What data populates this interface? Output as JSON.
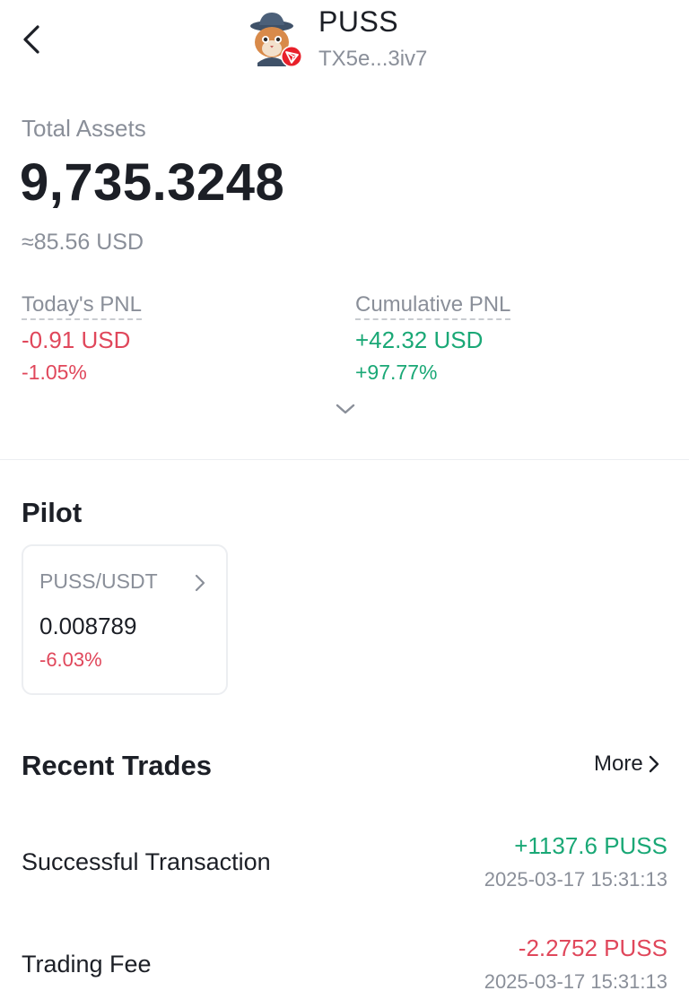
{
  "header": {
    "token_name": "PUSS",
    "address": "TX5e...3iv7"
  },
  "assets": {
    "label": "Total Assets",
    "value": "9,735.3248",
    "usd": "≈85.56 USD"
  },
  "pnl": {
    "today": {
      "label": "Today's PNL",
      "amount": "-0.91 USD",
      "percent": "-1.05%"
    },
    "cumulative": {
      "label": "Cumulative PNL",
      "amount": "+42.32 USD",
      "percent": "+97.77%"
    }
  },
  "pilot": {
    "title": "Pilot",
    "card": {
      "pair": "PUSS/USDT",
      "price": "0.008789",
      "change": "-6.03%"
    }
  },
  "recent_trades": {
    "title": "Recent Trades",
    "more_label": "More",
    "items": [
      {
        "title": "Successful Transaction",
        "amount": "+1137.6 PUSS",
        "time": "2025-03-17 15:31:13"
      },
      {
        "title": "Trading Fee",
        "amount": "-2.2752 PUSS",
        "time": "2025-03-17 15:31:13"
      }
    ]
  },
  "colors": {
    "positive": "#1aa876",
    "negative": "#e0475b",
    "muted": "#8a8f99",
    "text": "#1c1f26",
    "tron_badge": "#e8202a"
  },
  "icons": {
    "back": "chevron-left-icon",
    "expand": "chevron-down-icon",
    "card_link": "chevron-right-icon",
    "more": "chevron-right-icon",
    "chain_badge": "tron-icon"
  }
}
